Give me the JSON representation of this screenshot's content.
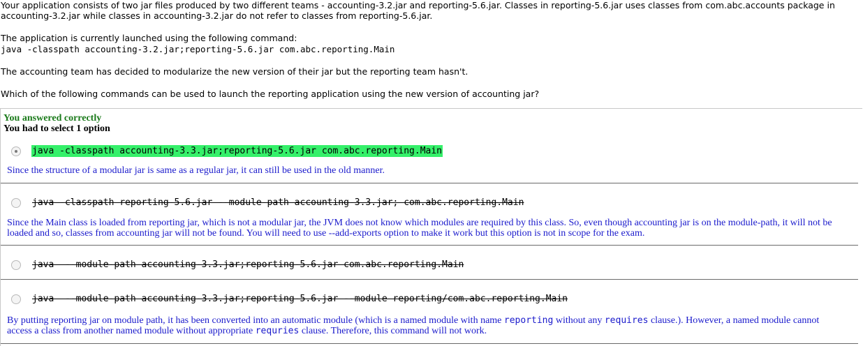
{
  "question": {
    "line1": "Your application consists of two jar files produced by two different teams - accounting-3.2.jar and reporting-5.6.jar. Classes in reporting-5.6.jar uses classes from com.abc.accounts package in",
    "line2": "accounting-3.2.jar while classes in accounting-3.2.jar do not refer to classes from reporting-5.6.jar.",
    "line3": "The application is currently launched using the following command:",
    "line4": "java -classpath accounting-3.2.jar;reporting-5.6.jar com.abc.reporting.Main",
    "line5": "The accounting team has decided to modularize the new version of their jar but the reporting team hasn't.",
    "line6": "Which of the following commands can be used to launch the reporting application using the new version of accounting jar?"
  },
  "result": {
    "status": "You answered correctly",
    "instruction": "You had to select 1 option"
  },
  "options": [
    {
      "text": "java -classpath accounting-3.3.jar;reporting-5.6.jar com.abc.reporting.Main",
      "explanation": "Since the structure of a modular jar is same as a regular jar, it can still be used in the old manner."
    },
    {
      "text": "java -classpath reporting-5.6.jar --module-path accounting-3.3.jar; com.abc.reporting.Main",
      "explanation_line1": "Since the Main class is loaded from reporting jar, which is not a modular jar, the JVM does not know which modules are required by this class. So, even though accounting jar is on the module-path, it will not be",
      "explanation_line2": "loaded and so, classes from accounting jar will not be found. You will need to use --add-exports option to make it work but this option is not in scope for the exam."
    },
    {
      "text": "java  --module-path accounting-3.3.jar;reporting-5.6.jar com.abc.reporting.Main"
    },
    {
      "text": "java  --module-path accounting-3.3.jar;reporting-5.6.jar --module reporting/com.abc.reporting.Main",
      "expl_a": "By putting reporting jar on module path, it has been converted into an automatic module (which is a named module with name ",
      "expl_b": "reporting",
      "expl_c": " without any ",
      "expl_d": "requires",
      "expl_e": " clause.). However, a named module cannot",
      "expl_f": "access a class from another named module without appropriate ",
      "expl_g": "requries",
      "expl_h": " clause. Therefore, this command will not work."
    }
  ]
}
